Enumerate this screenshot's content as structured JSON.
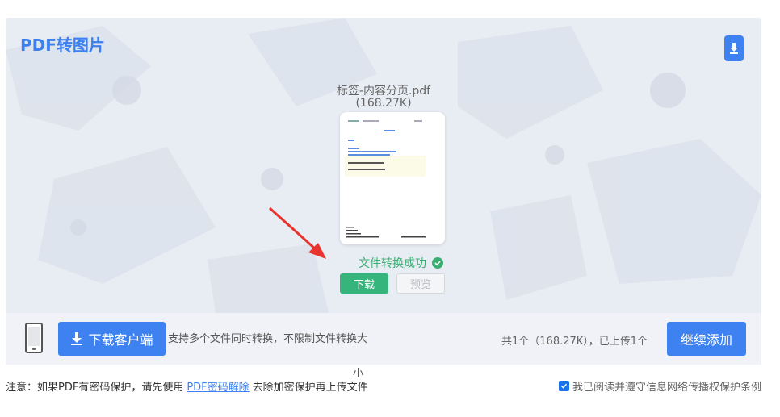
{
  "panel": {
    "title": "PDF转图片",
    "download_icon": "download-icon",
    "file": {
      "name": "标签-内容分页.pdf",
      "size": "(168.27K)"
    },
    "status": "文件转换成功",
    "status_icon": "check-circle-icon",
    "download_label": "下载",
    "preview_label": "预览"
  },
  "bar": {
    "client_label": "下载客户端",
    "tip": "支持多个文件同时转换，不限制文件转换大",
    "tip_tail": "小",
    "count": "共1个（168.27K），已上传1个",
    "continue_label": "继续添加"
  },
  "footer": {
    "note_prefix": "注意：如果PDF有密码保护，请先使用",
    "note_link": "PDF密码解除",
    "note_suffix": "去除加密保护再上传文件",
    "agree_label": "我已阅读并遵守信息网络传播权保护条例",
    "agree_checked": true
  },
  "colors": {
    "accent": "#3d82f0",
    "success": "#35b57b",
    "panel_bg": "#e8ecf3"
  }
}
